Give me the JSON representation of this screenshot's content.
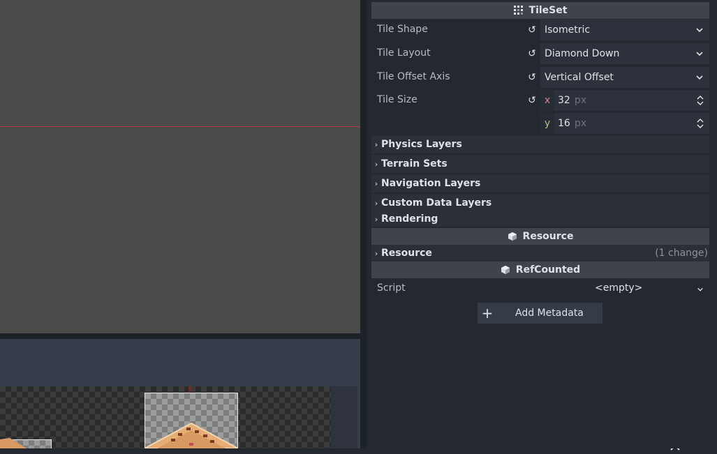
{
  "inspector": {
    "tileset_header": "TileSet",
    "properties": [
      {
        "label": "Tile Shape",
        "value": "Isometric"
      },
      {
        "label": "Tile Layout",
        "value": "Diamond Down"
      },
      {
        "label": "Tile Offset Axis",
        "value": "Vertical Offset"
      }
    ],
    "tile_size": {
      "label": "Tile Size",
      "x_axis": "x",
      "x_value": "32",
      "y_axis": "y",
      "y_value": "16",
      "unit": "px"
    },
    "sections": [
      "Physics Layers",
      "Terrain Sets",
      "Navigation Layers",
      "Custom Data Layers",
      "Rendering"
    ],
    "resource_header": "Resource",
    "resource_section": {
      "label": "Resource",
      "changes": "(1 change)"
    },
    "refcounted_header": "RefCounted",
    "script": {
      "label": "Script",
      "value": "<empty>"
    },
    "add_metadata_label": "Add Metadata"
  },
  "colors": {
    "accent_x": "#e06c75",
    "accent_y": "#a6e22e",
    "axis_line": "#b03a46"
  }
}
